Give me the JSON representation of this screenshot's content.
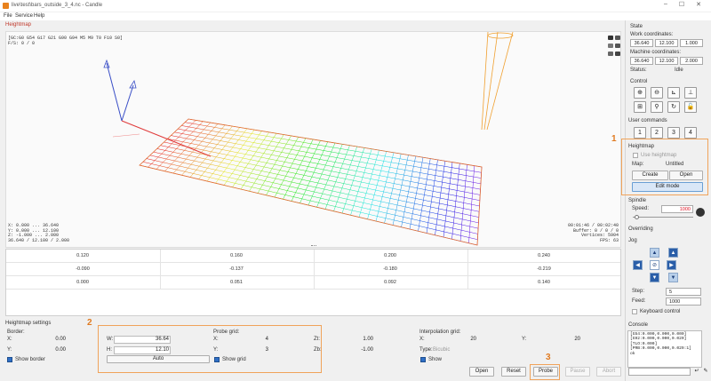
{
  "window": {
    "title": "live\\test\\bars_outside_3_4.nc - Candle"
  },
  "menu": [
    "File",
    "Service",
    "Help"
  ],
  "heightmap_section": "Heightmap",
  "view": {
    "gcode_state": "[GC:G0 G54 G17 G21 G90 G94 M5 M9 T0 F10 S0]",
    "fs": "F/S: 0 / 0",
    "bounds": "X: 0.000 ... 36.640\nY: 0.000 ... 12.100\nZ: -1.000 ... 2.000\n36.640 / 12.100 / 2.000",
    "stats": "00:01:46 / 00:02:40\nBuffer: 0 / 0 / 0\nVertices: 5904\nFPS: 63"
  },
  "table": [
    [
      "0.120",
      "0.160",
      "0.200",
      "0.240"
    ],
    [
      "-0.090",
      "-0.137",
      "-0.180",
      "-0.219"
    ],
    [
      "0.000",
      "0.051",
      "0.092",
      "0.140"
    ]
  ],
  "settings": {
    "title": "Heightmap settings",
    "border_label": "Border:",
    "border_x_label": "X:",
    "border_x": "0.00",
    "border_y_label": "Y:",
    "border_y": "0.00",
    "border_w_label": "W:",
    "border_w": "36.64",
    "border_h_label": "H:",
    "border_h": "12.10",
    "auto_button": "Auto",
    "show_border": "Show border",
    "probe_grid_label": "Probe grid:",
    "grid_x_label": "X:",
    "grid_x": "4",
    "grid_y_label": "Y:",
    "grid_y": "3",
    "zt_label": "Zt:",
    "zt": "1.00",
    "zb_label": "Zb:",
    "zb": "-1.00",
    "show_grid": "Show grid",
    "interp_label": "Interpolation grid:",
    "interp_x_label": "X:",
    "interp_x": "20",
    "interp_y_label": "Y:",
    "interp_y": "20",
    "type_label": "Type:",
    "type_value": "Bicubic",
    "show": "Show",
    "buttons": {
      "open": "Open",
      "reset": "Reset",
      "probe": "Probe",
      "pause": "Pause",
      "abort": "Abort"
    }
  },
  "right": {
    "state": "State",
    "work_coords": "Work coordinates:",
    "work": [
      "36.640",
      "12.100",
      "1.000"
    ],
    "machine_coords": "Machine coordinates:",
    "machine": [
      "36.640",
      "12.100",
      "2.000"
    ],
    "status_label": "Status:",
    "status": "Idle",
    "control": "Control",
    "user_commands": "User commands",
    "user_buttons": [
      "1",
      "2",
      "3",
      "4"
    ],
    "heightmap": "Heightmap",
    "use_heightmap": "Use heightmap",
    "map_label": "Map:",
    "map_value": "Untitled",
    "create": "Create",
    "open": "Open",
    "edit_mode": "Edit mode",
    "spindle": "Spindle",
    "speed_label": "Speed:",
    "speed": "1000",
    "overriding": "Overriding",
    "jog": "Jog",
    "step_label": "Step:",
    "step": "5",
    "feed_label": "Feed:",
    "feed": "1000",
    "keyboard_control": "Keyboard control",
    "console": "Console",
    "console_text": "[G54:0.000,0.000,0.000]\n[G92:0.000,0.000,0.020]\n[TLO:0.000]\n[PRB:0.000,0.000,0.029:1]\nok"
  },
  "annotations": [
    "1",
    "2",
    "3"
  ]
}
